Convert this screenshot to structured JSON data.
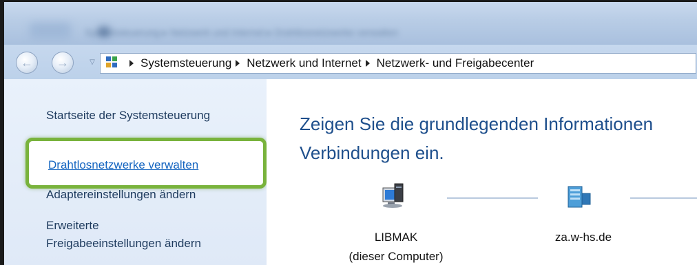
{
  "titlebar": {
    "blurred_path": "Systemsteuerung ▸ Netzwerk und Internet ▸ Drahtlosnetzwerke verwalten"
  },
  "address": {
    "crumbs": [
      "Systemsteuerung",
      "Netzwerk und Internet",
      "Netzwerk- und Freigabecenter"
    ]
  },
  "sidebar": {
    "items": [
      {
        "label": "Startseite der Systemsteuerung"
      },
      {
        "label": "Drahtlosnetzwerke verwalten"
      },
      {
        "label": "Adaptereinstellungen ändern"
      },
      {
        "label_line1": "Erweiterte",
        "label_line2": "Freigabeeinstellungen ändern"
      }
    ]
  },
  "main": {
    "heading_line1": "Zeigen Sie die grundlegenden Informationen",
    "heading_line2": "Verbindungen ein.",
    "nodes": [
      {
        "name": "LIBMAK",
        "sub": "(dieser Computer)",
        "icon": "computer-icon"
      },
      {
        "name": "za.w-hs.de",
        "icon": "domain-network-icon"
      }
    ]
  },
  "colors": {
    "highlight_border": "#79b33c",
    "link": "#1565c0",
    "heading": "#1e4f8c"
  }
}
